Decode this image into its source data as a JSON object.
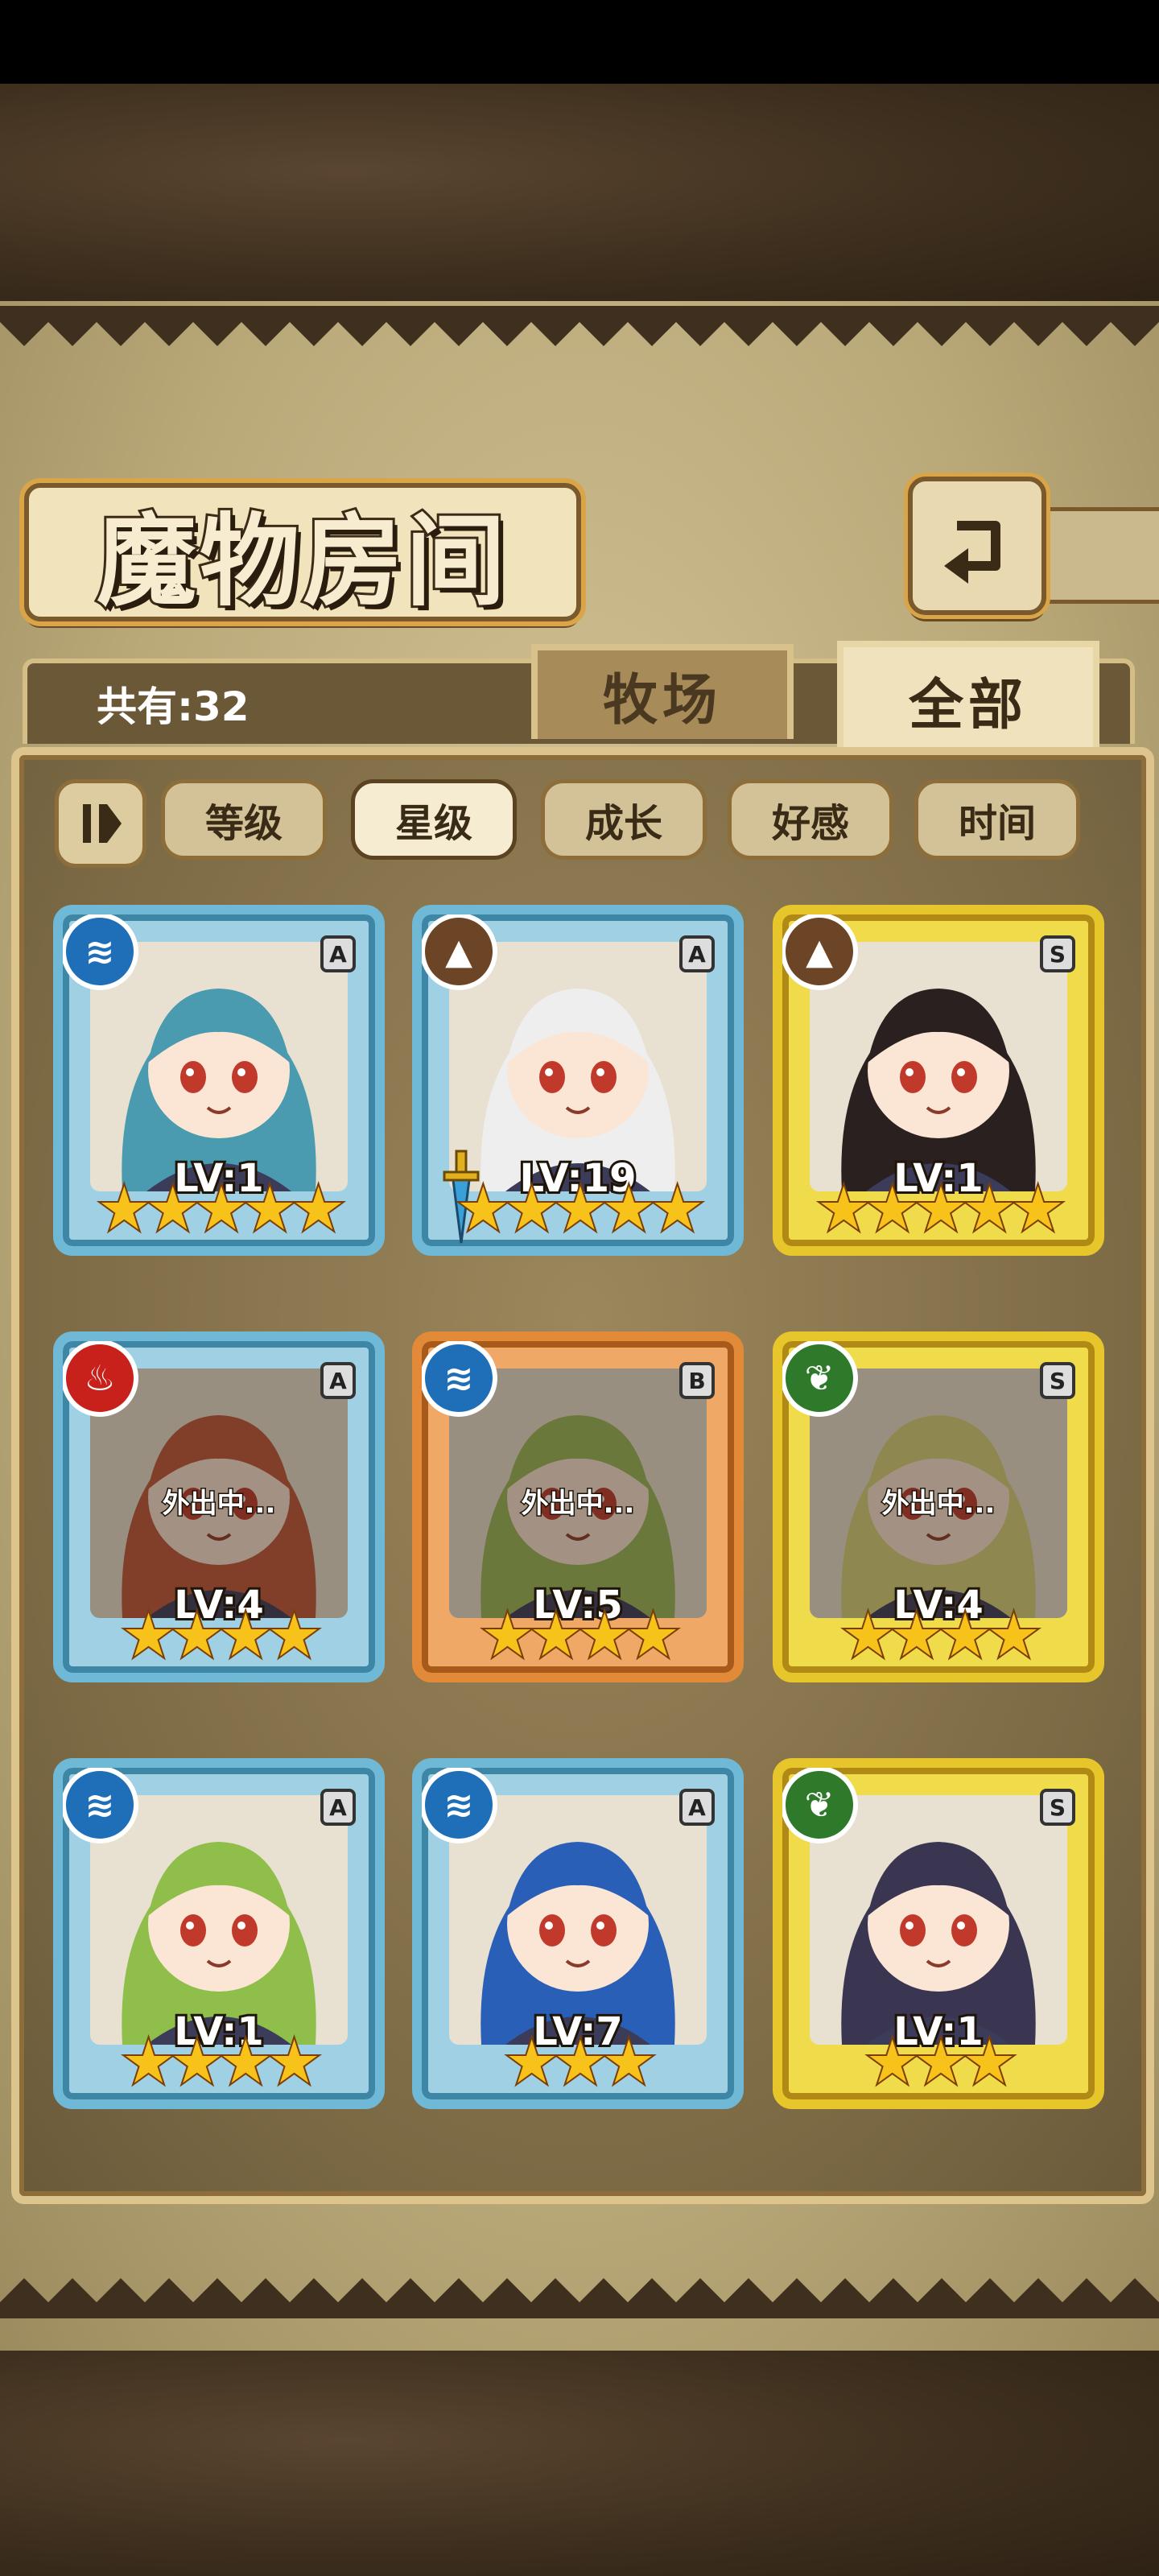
{
  "header": {
    "title": "魔物房间"
  },
  "summary": {
    "count_label": "共有:32"
  },
  "tabs": [
    {
      "label": "牧场",
      "active": false
    },
    {
      "label": "全部",
      "active": true
    }
  ],
  "sort": {
    "toggle_icon": "sort-order-icon",
    "options": [
      {
        "label": "等级",
        "active": false
      },
      {
        "label": "星级",
        "active": true
      },
      {
        "label": "成长",
        "active": false
      },
      {
        "label": "好感",
        "active": false
      },
      {
        "label": "时间",
        "active": false
      }
    ]
  },
  "monsters": [
    {
      "level": "LV:1",
      "rank": "A",
      "element": "water-icon",
      "stars": 5,
      "frame": "blue",
      "away": "",
      "hair": "#4a9bb0",
      "has_sword": false
    },
    {
      "level": "LV:19",
      "rank": "A",
      "element": "mountain-icon",
      "stars": 5,
      "frame": "blue",
      "away": "",
      "hair": "#eeeeee",
      "has_sword": true
    },
    {
      "level": "LV:1",
      "rank": "S",
      "element": "mountain-icon",
      "stars": 5,
      "frame": "gold",
      "away": "",
      "hair": "#2a2020",
      "has_sword": false
    },
    {
      "level": "LV:4",
      "rank": "A",
      "element": "fire-icon",
      "stars": 4,
      "frame": "blue",
      "away": "外出中...",
      "hair": "#c2553a",
      "has_sword": false
    },
    {
      "level": "LV:5",
      "rank": "B",
      "element": "water-icon",
      "stars": 4,
      "frame": "orange",
      "away": "外出中...",
      "hair": "#9ab85a",
      "has_sword": false
    },
    {
      "level": "LV:4",
      "rank": "S",
      "element": "leaf-icon",
      "stars": 4,
      "frame": "gold",
      "away": "外出中...",
      "hair": "#d8d27a",
      "has_sword": false
    },
    {
      "level": "LV:1",
      "rank": "A",
      "element": "water-icon",
      "stars": 4,
      "frame": "blue",
      "away": "",
      "hair": "#8fbf4a",
      "has_sword": false
    },
    {
      "level": "LV:7",
      "rank": "A",
      "element": "water-icon",
      "stars": 3,
      "frame": "blue",
      "away": "",
      "hair": "#2a5fb8",
      "has_sword": false
    },
    {
      "level": "LV:1",
      "rank": "S",
      "element": "leaf-icon",
      "stars": 3,
      "frame": "gold",
      "away": "",
      "hair": "#3a3550",
      "has_sword": false
    }
  ]
}
